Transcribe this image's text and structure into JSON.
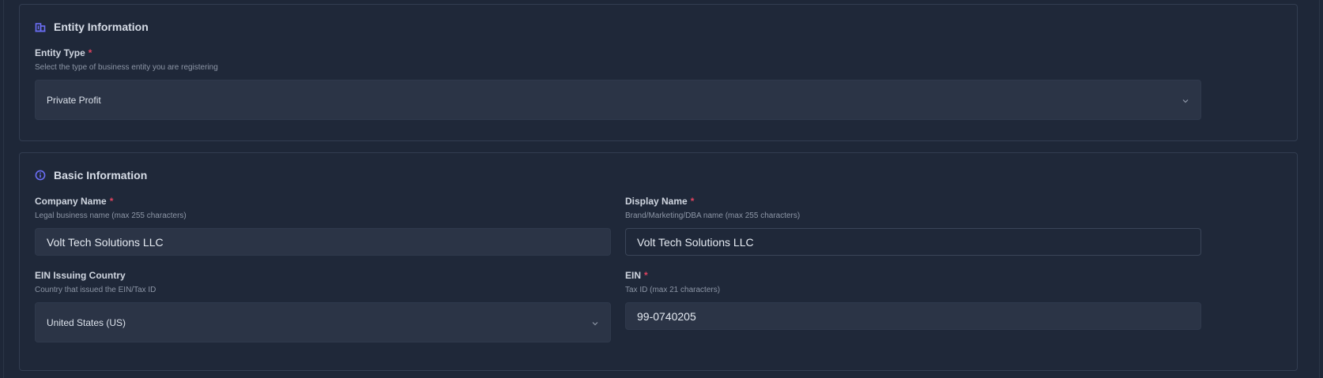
{
  "entity_section": {
    "title": "Entity Information",
    "icon": "building-icon",
    "entity_type": {
      "label": "Entity Type",
      "required": "*",
      "hint": "Select the type of business entity you are registering",
      "value": "Private Profit"
    }
  },
  "basic_section": {
    "title": "Basic Information",
    "icon": "info-circle-icon",
    "company_name": {
      "label": "Company Name",
      "required": "*",
      "hint": "Legal business name (max 255 characters)",
      "value": "Volt Tech Solutions LLC"
    },
    "display_name": {
      "label": "Display Name",
      "required": "*",
      "hint": "Brand/Marketing/DBA name (max 255 characters)",
      "value": "Volt Tech Solutions LLC"
    },
    "ein_country": {
      "label": "EIN Issuing Country",
      "hint": "Country that issued the EIN/Tax ID",
      "value": "United States (US)"
    },
    "ein": {
      "label": "EIN",
      "required": "*",
      "hint": "Tax ID (max 21 characters)",
      "value": "99-0740205"
    }
  },
  "colors": {
    "background": "#1e2738",
    "field": "#2b3446",
    "accent_icon": "#6b6ef5",
    "required": "#e0435f"
  }
}
